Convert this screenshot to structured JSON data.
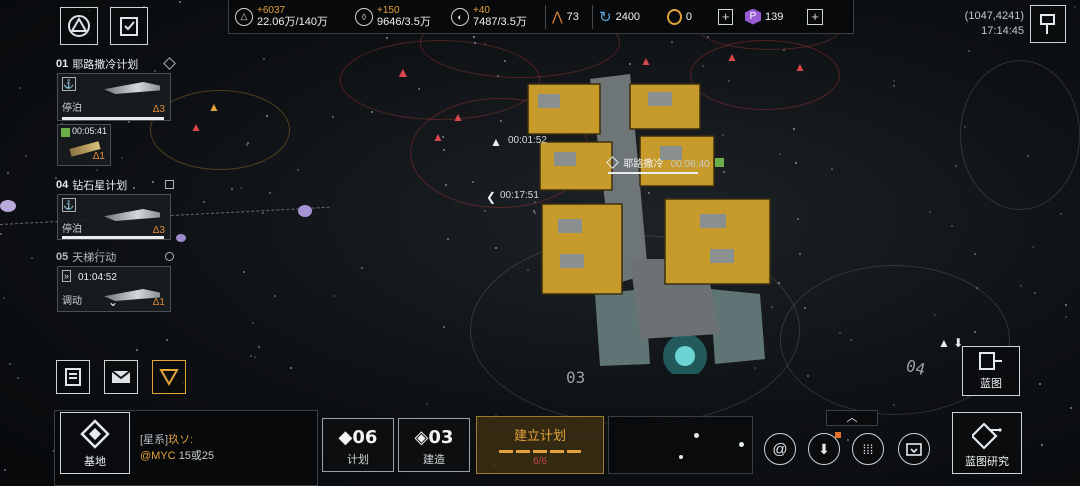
{
  "resources": {
    "r1": {
      "icon": "triangle-icon",
      "delta": "+6037",
      "value": "22.06万/140万"
    },
    "r2": {
      "icon": "crystal-icon",
      "delta": "+150",
      "value": "9646/3.5万"
    },
    "r3": {
      "icon": "gas-icon",
      "delta": "+40",
      "value": "7487/3.5万"
    },
    "r4": {
      "icon": "fleet-icon",
      "value": "73"
    },
    "r5": {
      "icon": "credit-icon",
      "value": "2400"
    },
    "r6": {
      "icon": "gold-coin-icon",
      "value": "0"
    },
    "r7": {
      "icon": "premium-p-icon",
      "value": "139"
    }
  },
  "header": {
    "coords": "(1047,4241)",
    "clock": "17:14:45"
  },
  "plans": [
    {
      "num": "01",
      "title": "耶路撒冷计划",
      "status": "停泊",
      "level": "Δ3",
      "sub_timer": "00:05:41",
      "sub_level": "Δ1"
    },
    {
      "num": "04",
      "title": "钻石星计划",
      "status": "停泊",
      "level": "Δ3"
    },
    {
      "num": "05",
      "title": "天梯行动",
      "status": "调动",
      "level": "Δ1",
      "timer": "01:04:52"
    }
  ],
  "map": {
    "ship_label": "耶路撒冷",
    "ship_timer": "00:06:40",
    "timer_a": "00:01:52",
    "timer_b": "00:17:51",
    "zone_a": "03",
    "zone_b": "04"
  },
  "side_buttons": {
    "blueprint": "蓝图"
  },
  "bottom": {
    "base_label": "基地",
    "chat_channel": "[星系]",
    "chat_text": "玖ソ:",
    "chat_user": "@MYC",
    "chat_msg": "15或25",
    "plan_count": "06",
    "plan_label": "计划",
    "build_count": "03",
    "build_label": "建造",
    "establish_label": "建立计划",
    "establish_progress": "6/6",
    "blueprint_research": "蓝图研究"
  },
  "colors": {
    "accent": "#e3a33a",
    "panel_bg": "#08090a",
    "hostile": "#d9474a"
  }
}
